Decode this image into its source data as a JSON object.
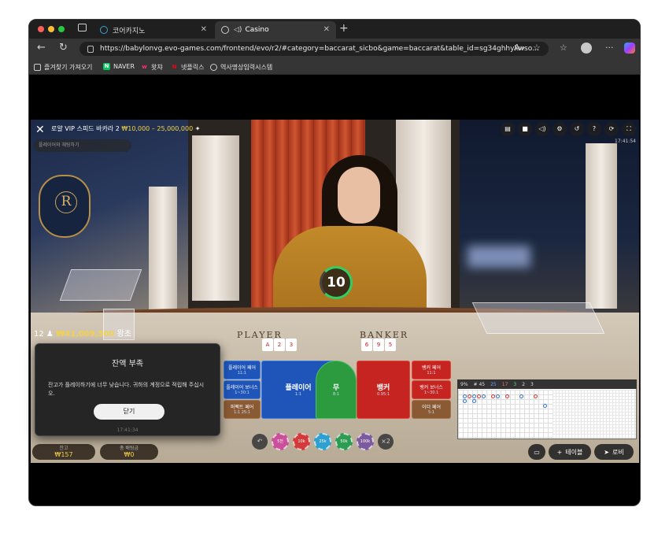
{
  "browser": {
    "tabs": [
      {
        "label": "코어카지노"
      },
      {
        "label": "Casino"
      }
    ],
    "url": "https://babylonvg.evo-games.com/frontend/evo/r2/#category=baccarat_sicbo&game=baccarat&table_id=sg34ghhykwso...",
    "bookmarks": [
      {
        "label": "즐겨찾기 가져오기"
      },
      {
        "label": "NAVER"
      },
      {
        "label": "왓챠"
      },
      {
        "label": "넷플릭스"
      },
      {
        "label": "역사명상입력시스템"
      }
    ]
  },
  "game": {
    "title": "로얄 VIP 스피드 바카라 2",
    "limits": "₩10,000 – 25,000,000",
    "chat_placeholder": "플레이어와 채팅하기",
    "time": "17:41:54",
    "timer": "10",
    "player_count": "12",
    "total_bet": "₩41,009,500",
    "total_bet_suffix": "왕초",
    "table_player": "PLAYER",
    "table_banker": "BANKER",
    "bets": {
      "player_pair": {
        "label": "플레이어 페어",
        "odds": "11:1"
      },
      "player_bonus": {
        "label": "플레이어 보너스",
        "odds": "1~30:1"
      },
      "perfect_pair": {
        "label": "퍼펙트 페어",
        "odds": "1:1 25:1"
      },
      "player": {
        "label": "플레이어",
        "odds": "1:1"
      },
      "tie": {
        "label": "무",
        "odds": "8:1"
      },
      "banker": {
        "label": "뱅커",
        "odds": "0.95:1"
      },
      "banker_pair": {
        "label": "뱅커 페어",
        "odds": "11:1"
      },
      "banker_bonus": {
        "label": "뱅커 보너스",
        "odds": "1~30:1"
      },
      "either_pair": {
        "label": "이더 페어",
        "odds": "5:1"
      }
    },
    "chips": [
      "5천",
      "10k",
      "25k",
      "50k",
      "100k"
    ],
    "chip_colors": [
      "#c94f9a",
      "#d33b3b",
      "#2f9fcf",
      "#2e9b52",
      "#7c5a9e"
    ],
    "double_label": "×2",
    "roadmap_stats": {
      "count": "9%",
      "total": "# 45",
      "p": "25",
      "b": "17",
      "t": "3",
      "pp": "2",
      "bp": "3"
    },
    "balance_label": "잔고",
    "balance": "₩157",
    "total_bet_label": "총 배팅금",
    "total_bet_value": "₩0",
    "table_button": "테이블",
    "lobby_button": "로비"
  },
  "dialog": {
    "title": "잔액 부족",
    "message": "잔고가 플레이하기에 너무 낮습니다. 귀하의 계정으로 적립해 주십시오.",
    "button": "닫기",
    "time": "17:41:34"
  },
  "colors": {
    "accent_gold": "#f3d24a",
    "player_blue": "#1f55b8",
    "banker_red": "#c52420",
    "tie_green": "#2c9b3f"
  }
}
